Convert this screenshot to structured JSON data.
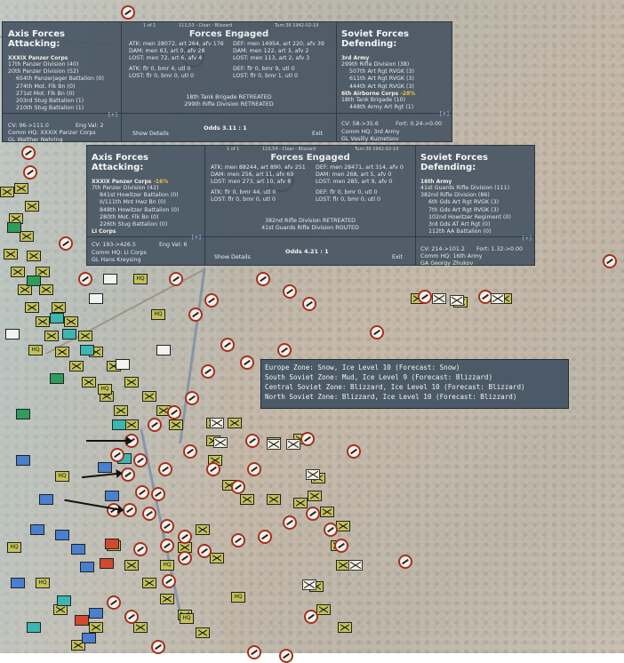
{
  "panel1": {
    "attacker_header": "Axis Forces Attacking:",
    "center_header": "Forces Engaged",
    "defender_header": "Soviet Forces Defending:",
    "page": "1 of 1",
    "hex_info": "111,53 - Clear - Blizzard",
    "turn_info": "Turn:36  1942-02-19",
    "attacker_corps": "XXXIX Panzer Corps",
    "attacker_divisions": [
      "17th Panzer Division (40)",
      "20th Panzer Division (52)"
    ],
    "attacker_units": [
      "654th Panzerjager Battalion (0)",
      "274th Mot. Flk Bn (0)",
      "271st Mot. Flk Bn (0)",
      "203rd Stug Battalion (1)",
      "210th Stug Battalion (1)"
    ],
    "attacker_expand": "[+]",
    "atk": "ATK: men 28072, art 264, afv 176",
    "dam": "DAM: men 63, art 0, afv 28",
    "lost": "LOST: men 72, art 6, afv 4",
    "atk2": "ATK: flr 0, bmr 4, utl 0",
    "lost2": "LOST: flr 0, bmr 0, utl 0",
    "def": "DEF: men 14954, art 220, afv 39",
    "def_dam": "DAM: men 122, art 3, afv 2",
    "def_lost": "LOST: men 113, art 2, afv 3",
    "def2": "DEF: flr 0, bmr 9, utl 0",
    "def_lost2": "LOST: flr 0, bmr 1, utl 0",
    "results": [
      "18th Tank Brigade RETREATED",
      "299th Rifle Division RETREATED"
    ],
    "defender_army": "3rd Army",
    "defender_division": "299th Rifle Division (38)",
    "defender_units": [
      "507th Art Rgt RVGK (3)",
      "611th Art Rgt RVGK (3)",
      "444th Art Rgt RVGK (3)"
    ],
    "defender_corps": "6th Airborne Corps",
    "defender_corps_pct": "-28%",
    "defender_brigade": "18th Tank Brigade (10)",
    "defender_brigade_units": [
      "448th Army Art Rgt (1)"
    ],
    "defender_expand": "[+]",
    "cv_left": "CV: 96->111.0",
    "eng_val": "Eng Val: 2",
    "comm_hq": "Comm HQ: XXXIX Panzer Corps",
    "leader": "GL Walther Nehring",
    "show_details": "Show Details",
    "odds": "Odds 3.11 : 1",
    "exit": "Exit",
    "cv_right": "CV: 58->35.6",
    "fort": "Fort: 0.24->0.00",
    "def_hq": "Comm HQ: 3rd Army",
    "def_leader": "GL Vasiliy Kuznetsov"
  },
  "panel2": {
    "attacker_header": "Axis Forces Attacking:",
    "center_header": "Forces Engaged",
    "defender_header": "Soviet Forces Defending:",
    "page": "1 of 1",
    "hex_info": "110,54 - Clear - Blizzard",
    "turn_info": "Turn:36  1942-02-19",
    "attacker_corps": "XXXIX Panzer Corps",
    "attacker_corps_pct": "-16%",
    "attacker_divisions": [
      "7th Panzer Division (42)"
    ],
    "attacker_units": [
      "841st Howitzer Battalion (0)",
      "II/111th Mnt Hwz Bn (0)",
      "848th Howitzer Battalion (0)",
      "280th Mot. Flk Bn (0)",
      "226th Stug Battalion (0)"
    ],
    "attacker_corps2": "LI Corps",
    "attacker_expand": "[+]",
    "atk": "ATK: men 88244, art 890, afv 251",
    "dam": "DAM: men 256, art 11, afv 69",
    "lost": "LOST: men 273, art 10, afv 8",
    "atk2": "ATK: flr 0, bmr 44, utl 0",
    "lost2": "LOST: flr 0, bmr 0, utl 0",
    "def": "DEF: men 28471, art 314, afv 0",
    "def_dam": "DAM: men 268, art 5, afv 0",
    "def_lost": "LOST: men 285, art 9, afv 0",
    "def2": "DEF: flr 0, bmr 0, utl 0",
    "def_lost2": "LOST: flr 0, bmr 0, utl 0",
    "results": [
      "382nd Rifle Division RETREATED",
      "41st Guards Rifle Division ROUTED"
    ],
    "defender_army": "16th Army",
    "defender_divisions": [
      "41st Guards Rifle Division (111)",
      "382nd Rifle Division (86)"
    ],
    "defender_units": [
      "6th Gds Art Rgt RVGK (3)",
      "7th Gds Art Rgt RVGK (3)",
      "102nd Howitzer Regiment (0)",
      "3rd Gds AT Art Rgt (0)",
      "112th AA Battalion (0)"
    ],
    "defender_expand": "[+]",
    "cv_left": "CV: 193->426.5",
    "eng_val": "Eng Val: 6",
    "comm_hq": "Comm HQ: LI Corps",
    "leader": "GL Hans Kreysing",
    "show_details": "Show Details",
    "odds": "Odds 4.21 : 1",
    "exit": "Exit",
    "cv_right": "CV: 214->101.2",
    "fort": "Fort: 1.32->0.00",
    "def_hq": "Comm HQ: 16th Army",
    "def_leader": "GA Georgy Zhukov"
  },
  "weather": {
    "lines": [
      "Europe Zone: Snow, Ice Level 10 (Forecast: Snow)",
      "South Soviet Zone: Mud, Ice Level 9 (Forecast: Blizzard)",
      "Central Soviet Zone: Blizzard, Ice Level 10 (Forecast: Blizzard)",
      "North Soviet Zone: Blizzard, Ice Level 10 (Forecast: Blizzard)"
    ]
  },
  "counters": {
    "hq_label": "HQ"
  },
  "colors": {
    "panel_bg": "#485664",
    "german_counter": "#c3c257",
    "soviet_ring": "#a2321e",
    "pct_highlight": "#f2c14a"
  }
}
